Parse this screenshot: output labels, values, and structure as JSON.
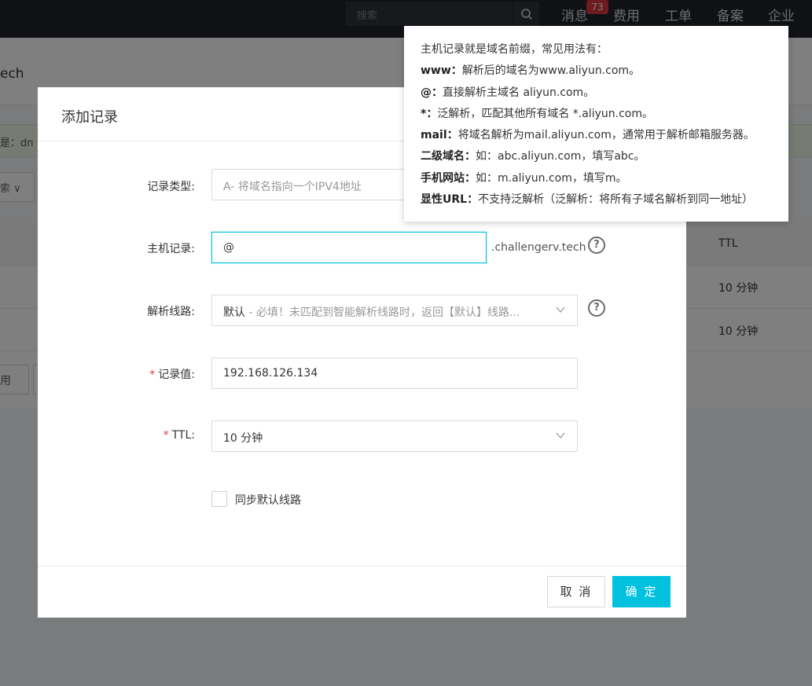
{
  "topbar": {
    "search_placeholder": "搜索",
    "nav": [
      "消息",
      "费用",
      "工单",
      "备案",
      "企业"
    ],
    "message_badge": "73"
  },
  "background": {
    "domain_fragment": "ech",
    "notice_fragment": "是：dn",
    "select_fragment": "索",
    "ttl_header": "TTL",
    "ttl_row1": "10 分钟",
    "ttl_row2": "10 分钟",
    "btn_fragment": "用"
  },
  "modal": {
    "title": "添加记录",
    "record_type": {
      "label": "记录类型:",
      "value": "A- 将域名指向一个IPV4地址"
    },
    "host_record": {
      "label": "主机记录:",
      "value": "@",
      "suffix": ".challengerv.tech"
    },
    "line": {
      "label": "解析线路:",
      "value": "默认",
      "hint": " - 必填！未匹配到智能解析线路时，返回【默认】线路..."
    },
    "record_value": {
      "label": "记录值:",
      "value": "192.168.126.134"
    },
    "ttl": {
      "label": "TTL:",
      "value": "10 分钟"
    },
    "sync": {
      "label": "同步默认线路",
      "checked": false
    },
    "cancel_label": "取 消",
    "ok_label": "确 定"
  },
  "tooltip": {
    "intro": "主机记录就是域名前缀，常见用法有：",
    "items": [
      {
        "key": "www：",
        "text": "解析后的域名为www.aliyun.com。"
      },
      {
        "key": "@：",
        "text": "直接解析主域名 aliyun.com。"
      },
      {
        "key": "*：",
        "text": "泛解析，匹配其他所有域名 *.aliyun.com。"
      },
      {
        "key": "mail：",
        "text": "将域名解析为mail.aliyun.com，通常用于解析邮箱服务器。"
      },
      {
        "key": "二级域名：",
        "text": "如：abc.aliyun.com，填写abc。"
      },
      {
        "key": "手机网站：",
        "text": "如：m.aliyun.com，填写m。"
      },
      {
        "key": "显性URL：",
        "text": "不支持泛解析（泛解析：将所有子域名解析到同一地址）"
      }
    ]
  },
  "colors": {
    "accent": "#00c1de",
    "required": "#e4393c",
    "badge": "#d9363e"
  }
}
